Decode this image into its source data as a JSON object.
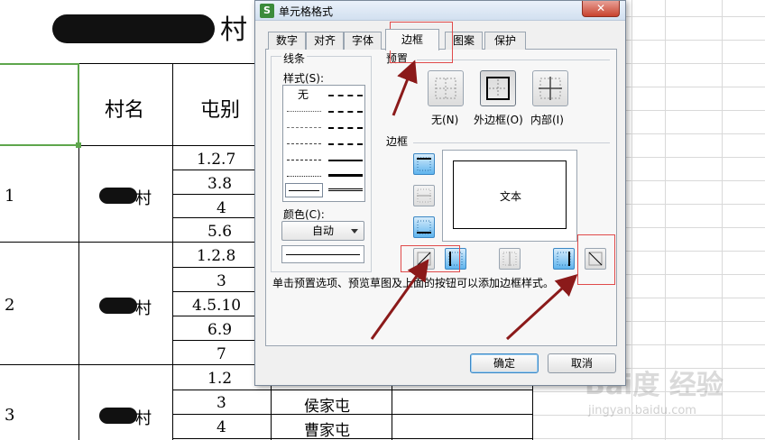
{
  "sheet": {
    "title_visible_part": "村",
    "header_village": "村名",
    "header_tun": "屯别",
    "row_numbers": [
      "1",
      "2",
      "3"
    ],
    "village_suffixes": [
      "村",
      "村",
      "村"
    ],
    "tun_codes": [
      "1.2.7",
      "3.8",
      "4",
      "5.6",
      "1.2.8",
      "3",
      "4.5.10",
      "6.9",
      "7",
      "1.2",
      "3",
      "4"
    ],
    "tun_names": [
      "侯家屯",
      "曹家屯"
    ]
  },
  "dialog": {
    "title": "单元格格式",
    "app_icon": "S",
    "close_label": "✕",
    "tabs": [
      "数字",
      "对齐",
      "字体",
      "边框",
      "图案",
      "保护"
    ],
    "active_tab": "边框",
    "line_group": "线条",
    "style_label": "样式(S):",
    "style_none": "无",
    "color_label": "颜色(C):",
    "color_value": "自动",
    "preset_group": "预置",
    "preset_none": "无(N)",
    "preset_outline": "外边框(O)",
    "preset_inside": "内部(I)",
    "border_group": "边框",
    "preview_text": "文本",
    "hint": "单击预置选项、预览草图及上面的按钮可以添加边框样式。",
    "ok_label": "确定",
    "cancel_label": "取消"
  },
  "colors": {
    "selection": "#5ea64c",
    "annotation": "#8b1a1a",
    "highlight_box": "#e04a4a",
    "active_border_button": "#5fb4ee"
  },
  "watermark": {
    "main": "Bai度 经验",
    "sub": "jingyan.baidu.com"
  }
}
